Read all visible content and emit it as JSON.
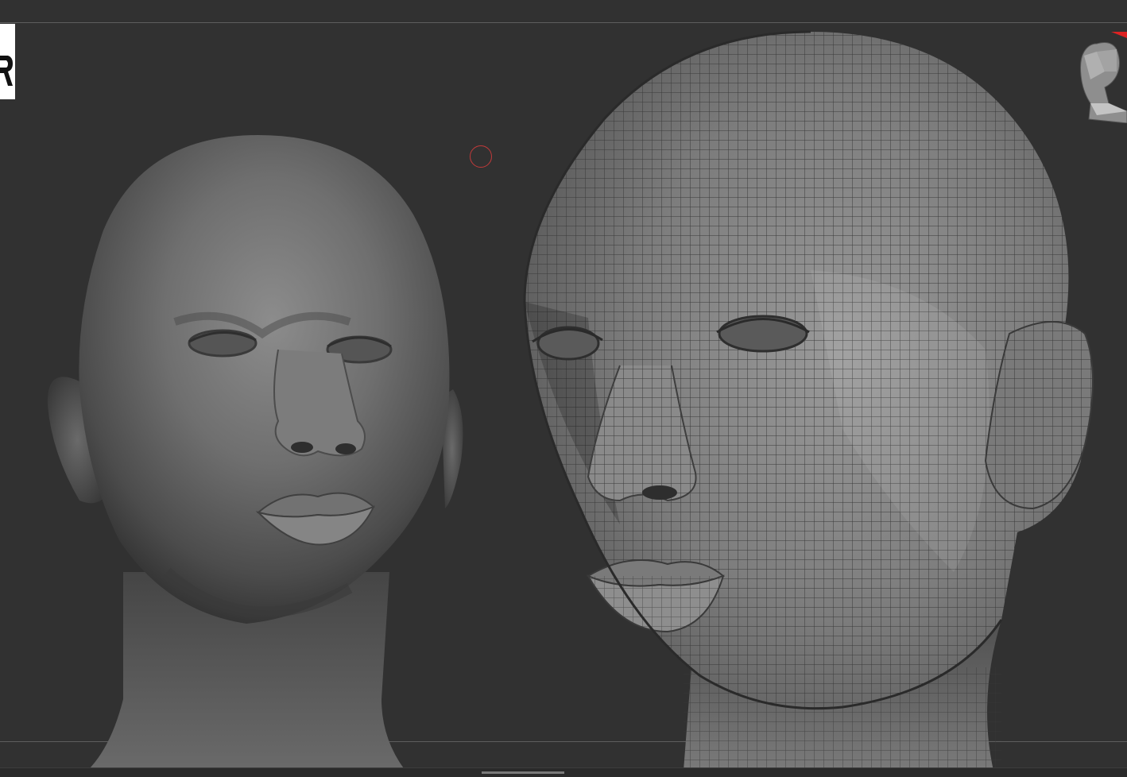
{
  "app": {
    "background": "#313131",
    "accent": "#c23a3a"
  },
  "viewport": {
    "models": [
      {
        "name": "sculpted-head",
        "shading": "smooth"
      },
      {
        "name": "wireframe-head",
        "shading": "polyframe"
      }
    ]
  },
  "icons": {
    "logo": "logo-icon",
    "brush_cursor": "brush-cursor-icon",
    "navigation_head": "navigation-head-icon",
    "axis_pointer": "axis-arrow-icon"
  }
}
